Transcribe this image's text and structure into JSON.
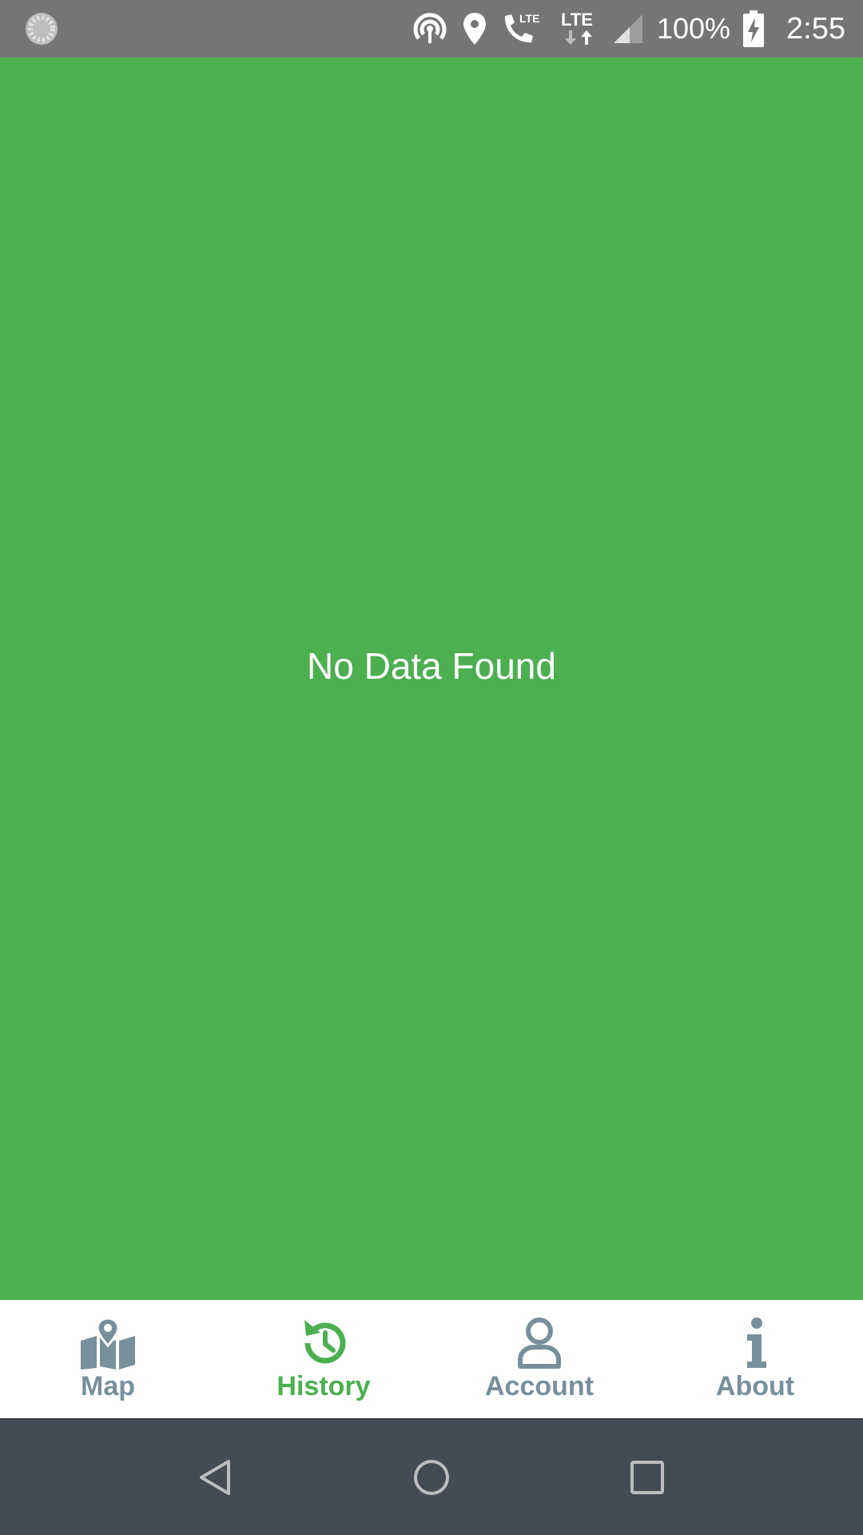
{
  "status_bar": {
    "battery_percent": "100%",
    "time": "2:55",
    "network_label_1": "LTE",
    "network_label_2": "LTE",
    "icons": [
      "sync-icon",
      "hotspot-icon",
      "location-icon",
      "volte-call-icon",
      "lte-data-icon",
      "signal-icon",
      "battery-charging-icon"
    ]
  },
  "main": {
    "empty_message": "No Data Found",
    "background_color": "#4caf50"
  },
  "bottom_nav": {
    "active_tab": "History",
    "active_color": "#4caf50",
    "inactive_color": "#78909c",
    "items": [
      {
        "label": "Map",
        "icon": "map-icon"
      },
      {
        "label": "History",
        "icon": "history-icon"
      },
      {
        "label": "Account",
        "icon": "person-icon"
      },
      {
        "label": "About",
        "icon": "info-icon"
      }
    ]
  },
  "system_nav": {
    "buttons": [
      "back-icon",
      "home-icon",
      "recents-icon"
    ]
  }
}
